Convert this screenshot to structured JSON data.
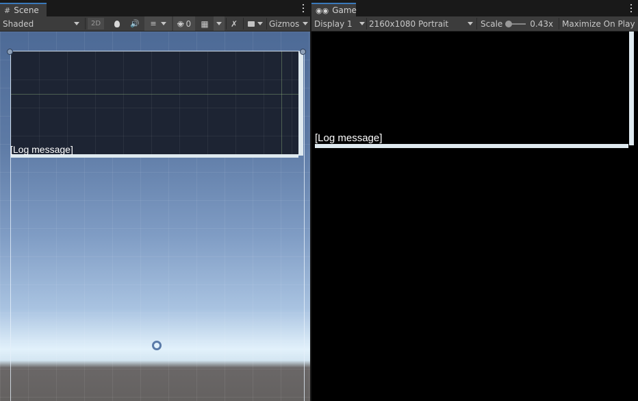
{
  "scene": {
    "tab_label": "Scene",
    "toolbar": {
      "draw_mode": "Shaded",
      "btn_2d": "2D",
      "hidden_count": "0",
      "gizmos_label": "Gizmos"
    },
    "log_text": "[Log message]"
  },
  "game": {
    "tab_label": "Game",
    "toolbar": {
      "display": "Display 1",
      "resolution": "2160x1080 Portrait",
      "scale_label": "Scale",
      "scale_value": "0.43x",
      "maximize_label": "Maximize On Play"
    },
    "log_text": "[Log message]"
  },
  "colors": {
    "accent": "#3a79bb",
    "panel_bg": "#3c3c3c",
    "tab_strip_bg": "#191919"
  }
}
